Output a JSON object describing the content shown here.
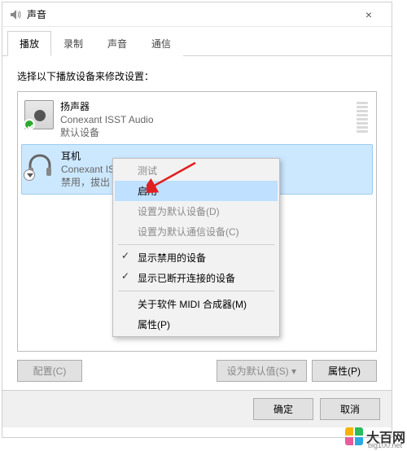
{
  "window": {
    "title": "声音",
    "close_label": "×"
  },
  "tabs": {
    "playback": "播放",
    "recording": "录制",
    "sound": "声音",
    "communication": "通信"
  },
  "instruction": "选择以下播放设备来修改设置：",
  "devices": [
    {
      "name": "扬声器",
      "subtitle": "Conexant ISST Audio",
      "status": "默认设备"
    },
    {
      "name": "耳机",
      "subtitle": "Conexant IS",
      "status": "禁用，拔出"
    }
  ],
  "context_menu": {
    "test": "测试",
    "enable": "启用",
    "set_default": "设置为默认设备(D)",
    "set_comm_default": "设置为默认通信设备(C)",
    "show_disabled": "显示禁用的设备",
    "show_disconnected": "显示已断开连接的设备",
    "about_midi": "关于软件 MIDI 合成器(M)",
    "properties": "属性(P)"
  },
  "buttons": {
    "configure": "配置(C)",
    "set_default_btn": "设为默认值(S)",
    "properties_btn": "属性(P)",
    "ok": "确定",
    "cancel": "取消"
  },
  "watermark": {
    "main": "大百网",
    "sub": "big100.net"
  }
}
